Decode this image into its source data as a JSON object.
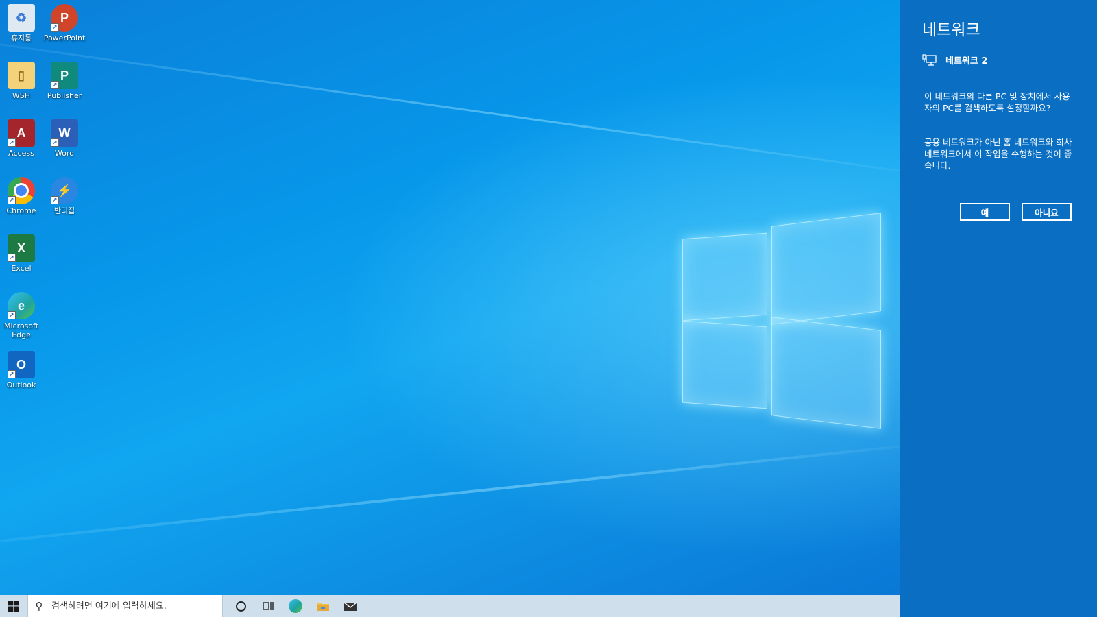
{
  "desktop": {
    "icons": [
      {
        "label": "휴지통",
        "icon": "recycle-bin-icon",
        "color": "#dfe9f1"
      },
      {
        "label": "PowerPoint",
        "icon": "powerpoint-icon",
        "color": "#d0452a"
      },
      {
        "label": "WSH",
        "icon": "folder-icon",
        "color": "#f3d27a"
      },
      {
        "label": "Publisher",
        "icon": "publisher-icon",
        "color": "#0f8a7d"
      },
      {
        "label": "Access",
        "icon": "access-icon",
        "color": "#a4262c"
      },
      {
        "label": "Word",
        "icon": "word-icon",
        "color": "#2b5fb8"
      },
      {
        "label": "Chrome",
        "icon": "chrome-icon",
        "color": "#ea4335"
      },
      {
        "label": "반디집",
        "icon": "bandizip-icon",
        "color": "#2a86e0"
      },
      {
        "label": "Excel",
        "icon": "excel-icon",
        "color": "#1d7a43"
      },
      {
        "label": "Microsoft Edge",
        "icon": "edge-icon",
        "color": "#1fa3a0"
      },
      {
        "label": "Outlook",
        "icon": "outlook-icon",
        "color": "#1166c2"
      }
    ]
  },
  "taskbar": {
    "search_placeholder": "검색하려면 여기에 입력하세요.",
    "pinned": [
      "cortana-icon",
      "task-view-icon",
      "edge-icon",
      "file-explorer-icon",
      "mail-icon"
    ]
  },
  "network_panel": {
    "title": "네트워크",
    "network_name": "네트워크 2",
    "question": "이 네트워크의 다른 PC 및 장치에서 사용자의 PC를 검색하도록 설정할까요?",
    "advice": "공용 네트워크가 아닌 홈 네트워크와 회사 네트워크에서 이 작업을 수행하는 것이 좋습니다.",
    "yes_label": "예",
    "no_label": "아니요"
  },
  "colors": {
    "panel_bg": "#0a6fc2",
    "taskbar_bg": "#cfe0ec",
    "wallpaper_accent": "#0797ea"
  }
}
